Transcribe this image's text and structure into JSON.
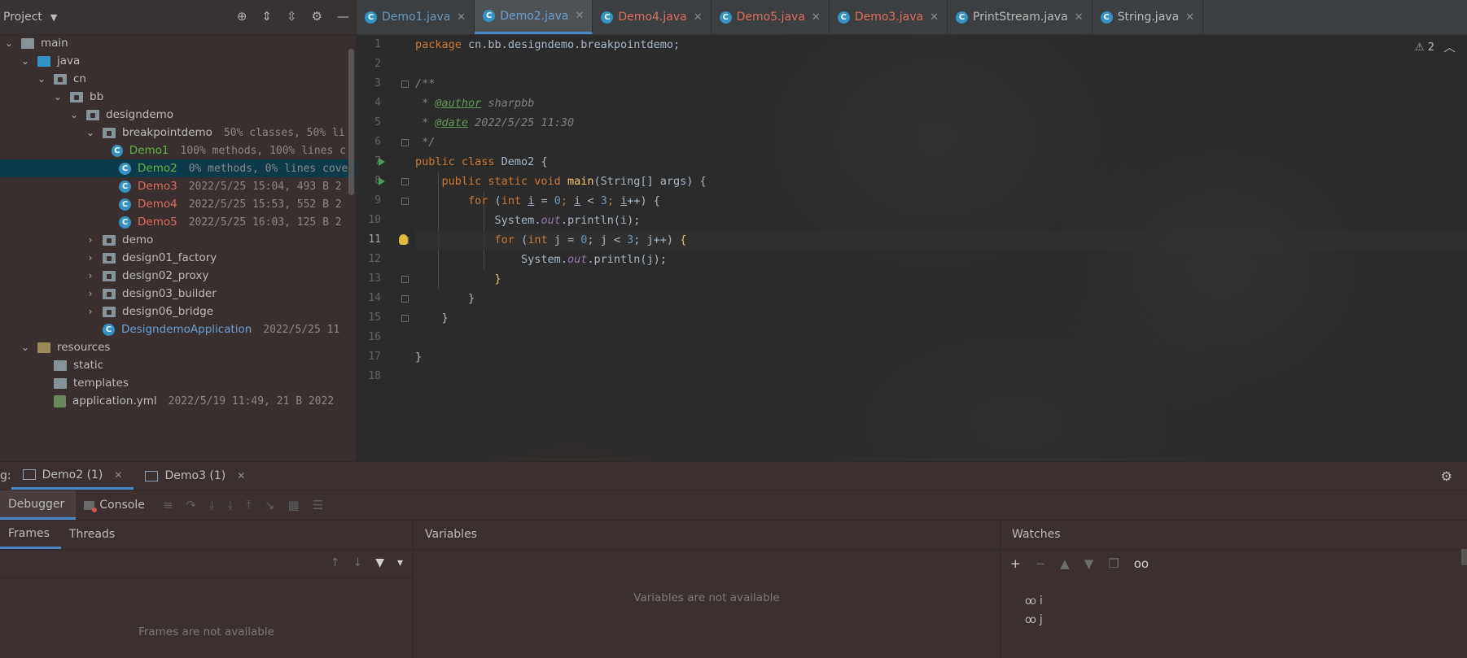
{
  "project": {
    "title": "Project",
    "tree": [
      {
        "label": "main",
        "kind": "folder",
        "level": 0,
        "expanded": true
      },
      {
        "label": "java",
        "kind": "folder-blue",
        "level": 1,
        "expanded": true
      },
      {
        "label": "cn",
        "kind": "pkg",
        "level": 2,
        "expanded": true
      },
      {
        "label": "bb",
        "kind": "pkg",
        "level": 3,
        "expanded": true
      },
      {
        "label": "designdemo",
        "kind": "pkg",
        "level": 4,
        "expanded": true
      },
      {
        "label": "breakpointdemo",
        "kind": "pkg",
        "level": 5,
        "expanded": true,
        "meta": "50% classes, 50% li"
      },
      {
        "label": "Demo1",
        "kind": "class",
        "level": 6,
        "color": "green",
        "meta": "100% methods, 100% lines c"
      },
      {
        "label": "Demo2",
        "kind": "class",
        "level": 6,
        "color": "green",
        "meta": "0% methods, 0% lines cove",
        "selected": true
      },
      {
        "label": "Demo3",
        "kind": "class",
        "level": 6,
        "color": "red",
        "meta": "2022/5/25 15:04, 493 B 2"
      },
      {
        "label": "Demo4",
        "kind": "class",
        "level": 6,
        "color": "red",
        "meta": "2022/5/25 15:53, 552 B 2"
      },
      {
        "label": "Demo5",
        "kind": "class",
        "level": 6,
        "color": "red",
        "meta": "2022/5/25 16:03, 125 B 2"
      },
      {
        "label": "demo",
        "kind": "pkg",
        "level": 5,
        "expanded": false
      },
      {
        "label": "design01_factory",
        "kind": "pkg",
        "level": 5,
        "expanded": false
      },
      {
        "label": "design02_proxy",
        "kind": "pkg",
        "level": 5,
        "expanded": false
      },
      {
        "label": "design03_builder",
        "kind": "pkg",
        "level": 5,
        "expanded": false
      },
      {
        "label": "design06_bridge",
        "kind": "pkg",
        "level": 5,
        "expanded": false
      },
      {
        "label": "DesigndemoApplication",
        "kind": "app",
        "level": 5,
        "color": "blue",
        "meta": "2022/5/25 11"
      },
      {
        "label": "resources",
        "kind": "res",
        "level": 1,
        "expanded": true
      },
      {
        "label": "static",
        "kind": "folder",
        "level": 2
      },
      {
        "label": "templates",
        "kind": "folder",
        "level": 2
      },
      {
        "label": "application.yml",
        "kind": "yml",
        "level": 2,
        "meta": "2022/5/19 11:49, 21 B 2022"
      }
    ]
  },
  "tabs": [
    {
      "label": "Demo1.java",
      "style": "blue"
    },
    {
      "label": "Demo2.java",
      "style": "blue",
      "active": true
    },
    {
      "label": "Demo4.java",
      "style": "mod"
    },
    {
      "label": "Demo5.java",
      "style": "mod"
    },
    {
      "label": "Demo3.java",
      "style": "mod"
    },
    {
      "label": "PrintStream.java",
      "style": "plain"
    },
    {
      "label": "String.java",
      "style": "plain"
    }
  ],
  "editor": {
    "line_numbers": [
      "1",
      "2",
      "3",
      "4",
      "5",
      "6",
      "7",
      "8",
      "9",
      "10",
      "11",
      "12",
      "13",
      "14",
      "15",
      "16",
      "17",
      "18"
    ],
    "warning_count": "2",
    "code": {
      "l1": "package cn.bb.designdemo.breakpointdemo;",
      "l3": "/**",
      "l4_pre": " * ",
      "l4_tag": "@author",
      "l4_val": " sharpbb",
      "l5_pre": " * ",
      "l5_tag": "@date",
      "l5_val": " 2022/5/25 11:30",
      "l6": " */",
      "l7_kw": "public class",
      "l7_rest": " Demo2 {",
      "l8_kw": "public static void",
      "l8_fn": "main",
      "l8_rest": "(String[] args) {",
      "l9_kw": "for",
      "l9_a": " (",
      "l9_int": "int",
      "l9_i1": "i",
      "l9_b": " = ",
      "l9_n0": "0",
      "l9_c": "; ",
      "l9_i2": "i",
      "l9_d": " < ",
      "l9_n3": "3",
      "l9_e": "; ",
      "l9_i3": "i",
      "l9_f": "++) {",
      "l10_a": "System.",
      "l10_out": "out",
      "l10_b": ".println(i);",
      "l11_kw": "for",
      "l11_a": " (",
      "l11_int": "int",
      "l11_b": " j = ",
      "l11_n0": "0",
      "l11_c": "; j < ",
      "l11_n3": "3",
      "l11_d": "; j++) ",
      "l11_brace": "{",
      "l12_a": "System.",
      "l12_out": "out",
      "l12_b": ".println(j);",
      "l13": "}",
      "l14": "}",
      "l15": "}",
      "l17": "}"
    }
  },
  "debug": {
    "prefix": "g:",
    "sessions": [
      {
        "label": "Demo2 (1)",
        "active": true
      },
      {
        "label": "Demo3 (1)"
      }
    ],
    "tabs": {
      "debugger": "Debugger",
      "console": "Console"
    },
    "frames": {
      "tab_frames": "Frames",
      "tab_threads": "Threads",
      "empty": "Frames are not available"
    },
    "variables": {
      "title": "Variables",
      "empty": "Variables are not available"
    },
    "watches": {
      "title": "Watches",
      "items": [
        "i",
        "j"
      ]
    }
  }
}
